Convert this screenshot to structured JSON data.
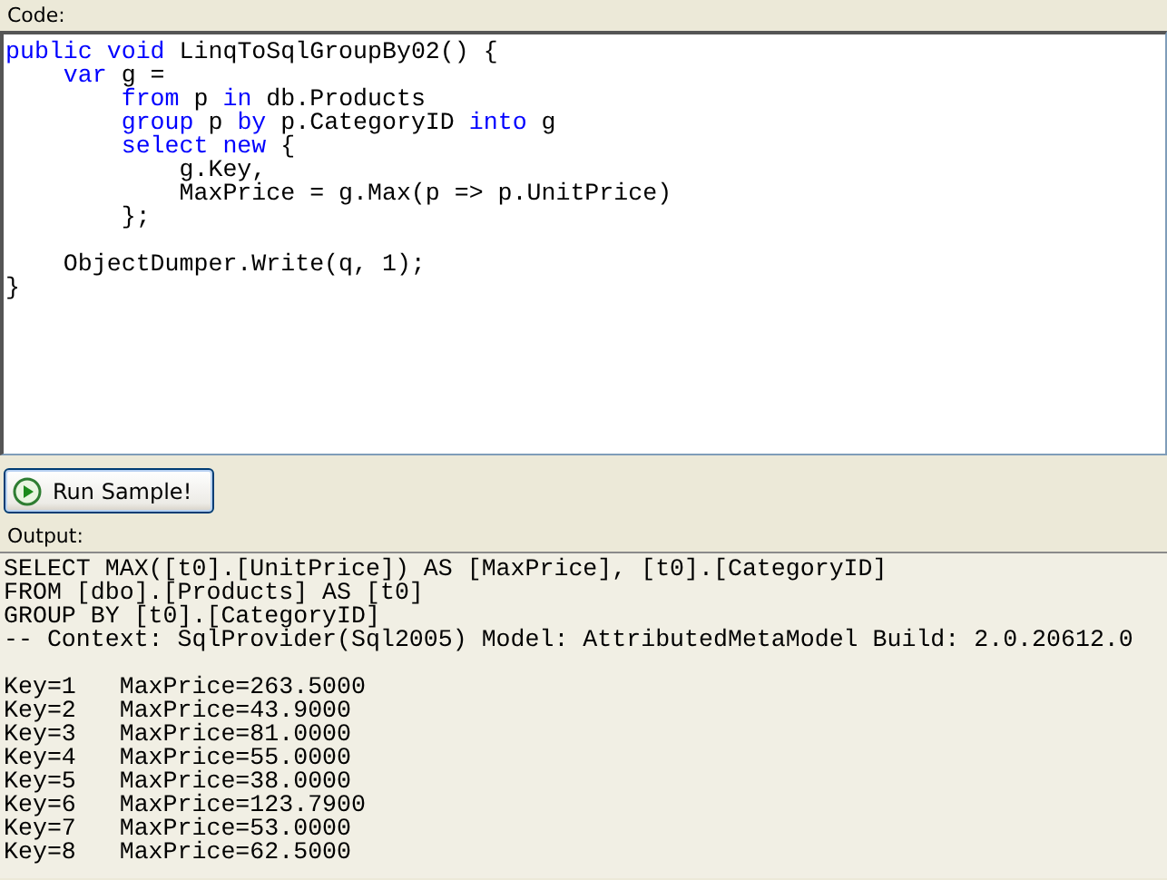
{
  "code_label": "Code:",
  "code_blocks": [
    {
      "lines": [
        {
          "tokens": [
            {
              "text": "public",
              "kind": "keyword"
            },
            {
              "text": " void",
              "kind": "keyword"
            },
            {
              "text": " LinqToSqlGroupBy02() {",
              "kind": "plain"
            }
          ]
        },
        {
          "tokens": [
            {
              "text": "    var",
              "kind": "keyword"
            },
            {
              "text": " g =",
              "kind": "plain"
            }
          ]
        },
        {
          "tokens": [
            {
              "text": "        from",
              "kind": "keyword"
            },
            {
              "text": " p ",
              "kind": "plain"
            },
            {
              "text": "in",
              "kind": "keyword"
            },
            {
              "text": " db.Products",
              "kind": "plain"
            }
          ]
        },
        {
          "tokens": [
            {
              "text": "        group",
              "kind": "keyword"
            },
            {
              "text": " p ",
              "kind": "plain"
            },
            {
              "text": "by",
              "kind": "keyword"
            },
            {
              "text": " p.CategoryID ",
              "kind": "plain"
            },
            {
              "text": "into",
              "kind": "keyword"
            },
            {
              "text": " g",
              "kind": "plain"
            }
          ]
        },
        {
          "tokens": [
            {
              "text": "        select",
              "kind": "keyword"
            },
            {
              "text": " new",
              "kind": "keyword"
            },
            {
              "text": " {",
              "kind": "plain"
            }
          ]
        },
        {
          "tokens": [
            {
              "text": "            g.Key,",
              "kind": "plain"
            }
          ]
        },
        {
          "tokens": [
            {
              "text": "            MaxPrice = g.Max(p => p.UnitPrice)",
              "kind": "plain"
            }
          ]
        },
        {
          "tokens": [
            {
              "text": "        };",
              "kind": "plain"
            }
          ]
        }
      ]
    },
    {
      "lines": [
        {
          "tokens": [
            {
              "text": "    ObjectDumper.Write(q, 1);",
              "kind": "plain"
            }
          ]
        },
        {
          "tokens": [
            {
              "text": "}",
              "kind": "plain"
            }
          ]
        }
      ]
    }
  ],
  "run_button": {
    "label": "Run Sample!"
  },
  "output_label": "Output:",
  "output_blocks": [
    {
      "lines": [
        "SELECT MAX([t0].[UnitPrice]) AS [MaxPrice], [t0].[CategoryID]",
        "FROM [dbo].[Products] AS [t0]",
        "GROUP BY [t0].[CategoryID]",
        "-- Context: SqlProvider(Sql2005) Model: AttributedMetaModel Build: 2.0.20612.0"
      ]
    },
    {
      "lines": [
        "Key=1   MaxPrice=263.5000",
        "Key=2   MaxPrice=43.9000",
        "Key=3   MaxPrice=81.0000",
        "Key=4   MaxPrice=55.0000",
        "Key=5   MaxPrice=38.0000",
        "Key=6   MaxPrice=123.7900",
        "Key=7   MaxPrice=53.0000",
        "Key=8   MaxPrice=62.5000"
      ]
    }
  ]
}
